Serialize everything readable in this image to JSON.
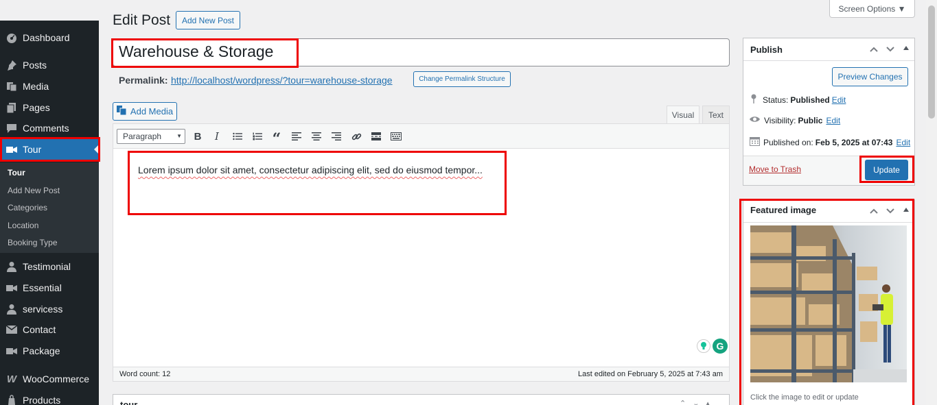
{
  "sidebar": {
    "items": [
      {
        "label": "Dashboard",
        "icon": "dashboard-icon"
      },
      {
        "label": "Posts",
        "icon": "pin-icon"
      },
      {
        "label": "Media",
        "icon": "media-icon"
      },
      {
        "label": "Pages",
        "icon": "pages-icon"
      },
      {
        "label": "Comments",
        "icon": "comments-icon"
      },
      {
        "label": "Tour",
        "icon": "video-icon"
      },
      {
        "label": "Testimonial",
        "icon": "person-icon"
      },
      {
        "label": "Essential",
        "icon": "video-icon"
      },
      {
        "label": "servicess",
        "icon": "person-icon"
      },
      {
        "label": "Contact",
        "icon": "envelope-icon"
      },
      {
        "label": "Package",
        "icon": "video-icon"
      },
      {
        "label": "WooCommerce",
        "icon": "woo-icon"
      },
      {
        "label": "Products",
        "icon": "products-icon"
      }
    ],
    "submenu": [
      "Tour",
      "Add New Post",
      "Categories",
      "Location",
      "Booking Type"
    ]
  },
  "header": {
    "title": "Edit Post",
    "add_new": "Add New Post",
    "screen_options": "Screen Options ▼"
  },
  "post": {
    "title": "Warehouse & Storage",
    "permalink_label": "Permalink:",
    "permalink_url": "http://localhost/wordpress/?tour=warehouse-storage",
    "change_permalink": "Change Permalink Structure"
  },
  "editor": {
    "add_media": "Add Media",
    "tab_visual": "Visual",
    "tab_text": "Text",
    "format": "Paragraph",
    "content": "Lorem ipsum dolor sit amet, consectetur adipiscing elit, sed do eiusmod tempor...",
    "word_count": "Word count: 12",
    "last_edited": "Last edited on February 5, 2025 at 7:43 am"
  },
  "tour_box": {
    "title": "tour"
  },
  "publish": {
    "title": "Publish",
    "preview": "Preview Changes",
    "status_label": "Status:",
    "status_value": "Published",
    "visibility_label": "Visibility:",
    "visibility_value": "Public",
    "published_label": "Published on:",
    "published_value": "Feb 5, 2025 at 07:43",
    "edit": "Edit",
    "trash": "Move to Trash",
    "update": "Update"
  },
  "featured": {
    "title": "Featured image",
    "hint": "Click the image to edit or update"
  }
}
